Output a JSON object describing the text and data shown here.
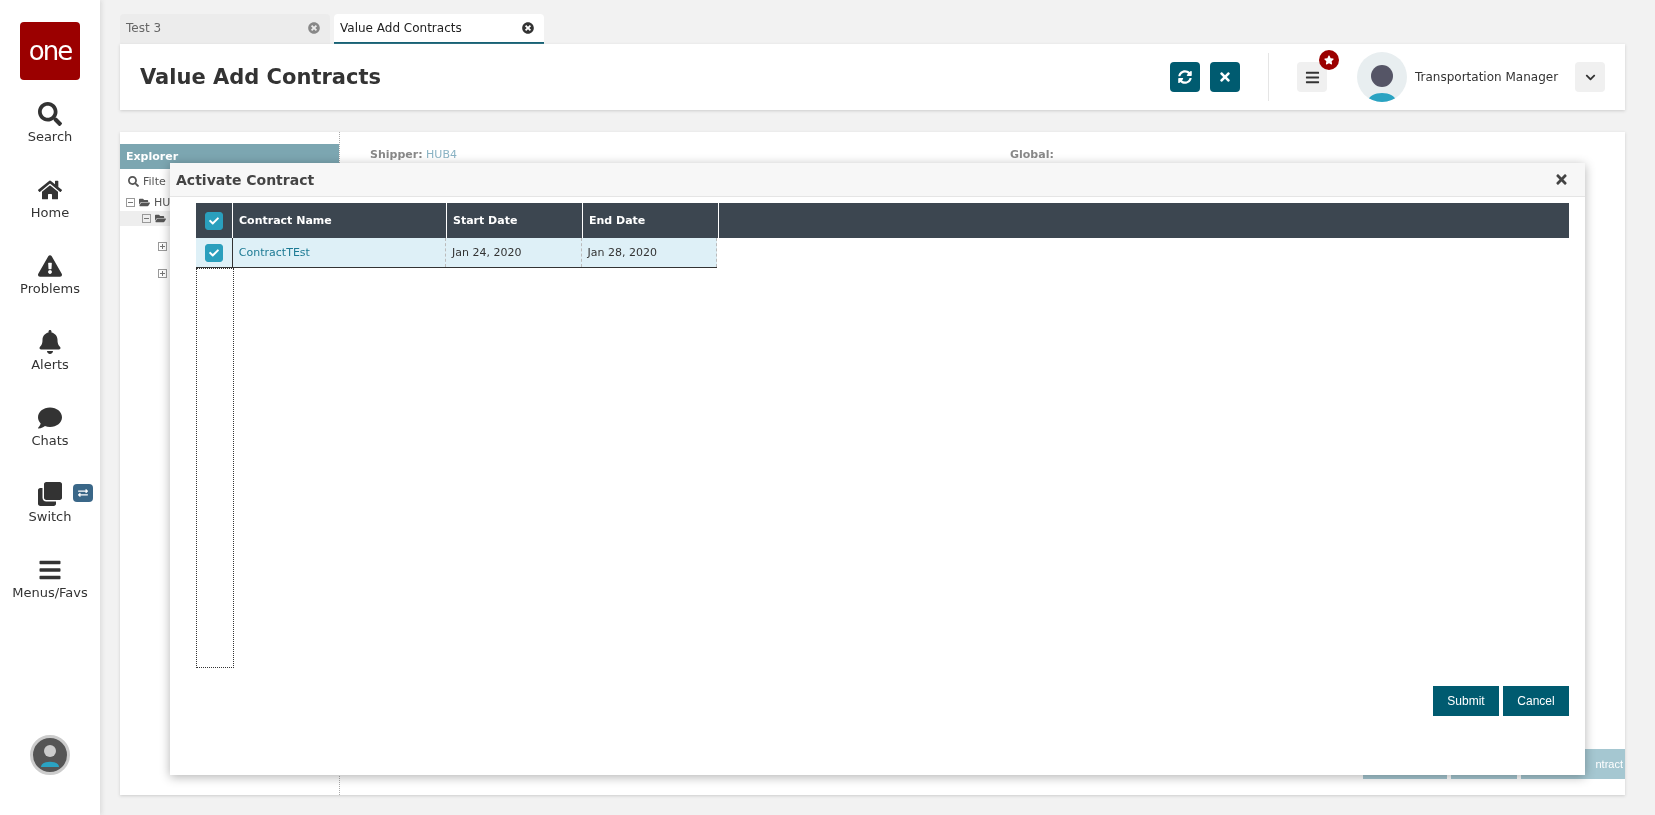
{
  "sidebar": {
    "logo": "one",
    "items": [
      {
        "label": "Search"
      },
      {
        "label": "Home"
      },
      {
        "label": "Problems"
      },
      {
        "label": "Alerts"
      },
      {
        "label": "Chats"
      },
      {
        "label": "Switch"
      },
      {
        "label": "Menus/Favs"
      }
    ]
  },
  "tabs": [
    {
      "label": "Test 3",
      "selected": false
    },
    {
      "label": "Value Add Contracts",
      "selected": true
    }
  ],
  "header": {
    "title": "Value Add Contracts",
    "role": "Transportation Manager"
  },
  "explorer": {
    "title": "Explorer",
    "filter_placeholder": "Filte",
    "tree": [
      {
        "label": "HU",
        "expanded": true,
        "children": [
          {
            "expanded": true,
            "children": [
              {
                "expanded": false
              },
              {
                "expanded": false
              }
            ]
          }
        ]
      }
    ]
  },
  "details": {
    "shipper_label": "Shipper:",
    "shipper": "HUB4",
    "global_label": "Global:"
  },
  "footer_button": "ntract",
  "dialog": {
    "title": "Activate Contract",
    "select_all": true,
    "columns": [
      "Contract Name",
      "Start Date",
      "End Date"
    ],
    "rows": [
      {
        "checked": true,
        "selected": true,
        "cells": [
          "ContractTEst",
          "Jan 24, 2020",
          "Jan 28, 2020"
        ]
      }
    ],
    "buttons": [
      "Submit",
      "Cancel"
    ]
  }
}
